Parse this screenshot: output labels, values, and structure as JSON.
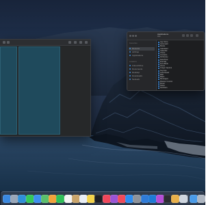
{
  "finder": {
    "title": "Applications",
    "subtitle": "Mac",
    "sidebar": {
      "section1": "Favourites",
      "items": [
        "Recents",
        "AirDrop",
        "Applications"
      ],
      "section2": "Locations",
      "locations": [
        "iCloud Drive",
        "Documents",
        "Desktop",
        "Downloads",
        "Network"
      ]
    },
    "files": [
      "App Store",
      "Automator",
      "Books",
      "Calculator",
      "Calendar",
      "Chess",
      "Contacts",
      "Dictionary",
      "FaceTime",
      "Find My",
      "Font Book",
      "Home",
      "Image Capture",
      "Keynote",
      "Launchpad",
      "Mail",
      "Maps",
      "Messages",
      "Mission Control",
      "Music",
      "Notes",
      "Numbers"
    ]
  },
  "dock": {
    "items": [
      {
        "name": "finder-icon",
        "color": "#3a88e0"
      },
      {
        "name": "launchpad-icon",
        "color": "#9aa7b8"
      },
      {
        "name": "safari-icon",
        "color": "#2f8fd8"
      },
      {
        "name": "messages-icon",
        "color": "#35c759"
      },
      {
        "name": "mail-icon",
        "color": "#3d8ff0"
      },
      {
        "name": "maps-icon",
        "color": "#5bbf6c"
      },
      {
        "name": "photos-icon",
        "color": "#f2a23b"
      },
      {
        "name": "facetime-icon",
        "color": "#2fbf57"
      },
      {
        "name": "calendar-icon",
        "color": "#f4f4f4"
      },
      {
        "name": "contacts-icon",
        "color": "#c9a46b"
      },
      {
        "name": "reminders-icon",
        "color": "#e9eef5"
      },
      {
        "name": "notes-icon",
        "color": "#f4d34a"
      },
      {
        "name": "tv-icon",
        "color": "#1d1f24"
      },
      {
        "name": "music-icon",
        "color": "#f0475b"
      },
      {
        "name": "podcasts-icon",
        "color": "#9a54d6"
      },
      {
        "name": "news-icon",
        "color": "#f04a5a"
      },
      {
        "name": "app-store-icon",
        "color": "#2d8cf0"
      },
      {
        "name": "system-preferences-icon",
        "color": "#8e939b"
      },
      {
        "name": "xcode-icon",
        "color": "#2f7bd8"
      },
      {
        "name": "code-editor-icon",
        "color": "#1e7ad6"
      },
      {
        "name": "screen-sharing-icon",
        "color": "#b54ed6"
      },
      {
        "name": "terminal-icon",
        "color": "#2b2d31"
      },
      {
        "name": "archive-icon",
        "color": "#e8b04a"
      },
      {
        "name": "preview-icon",
        "color": "#cfd6df"
      },
      {
        "name": "downloads-folder-icon",
        "color": "#4a9be8"
      },
      {
        "name": "trash-icon",
        "color": "#aeb6c1"
      }
    ]
  }
}
